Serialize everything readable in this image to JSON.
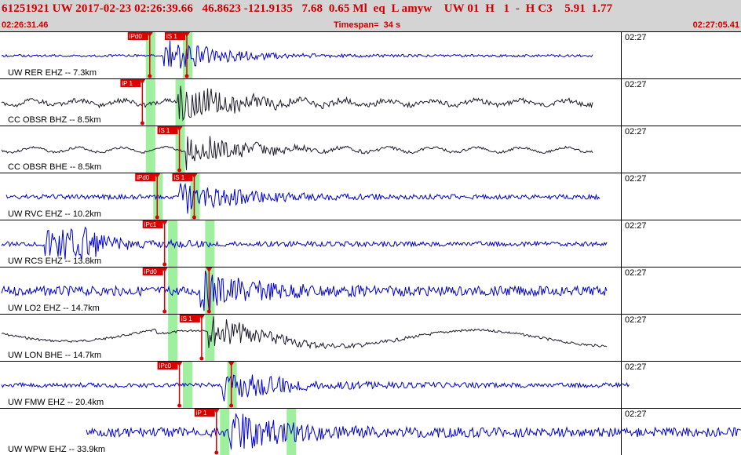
{
  "header": {
    "event_line": "61251921 UW 2017-02-23 02:26:39.66   46.8623 -121.9135   7.68  0.65 Ml  eq  L amyw    UW 01  H   1  -  H C3    5.91  1.77",
    "start_time": "02:26:31.46",
    "timespan": "Timespan=  34 s",
    "end_time": "02:27:05.41"
  },
  "time_marker": "02:27",
  "colors": {
    "header_bg": "#d4d4d4",
    "header_text": "#cc0000",
    "trace_blue": "#0000cc",
    "trace_black": "#1a1a2a",
    "pick": "#dd0000",
    "window": "#9ef09e"
  },
  "traces": [
    {
      "label": "UW RER EHZ -- 7.3km",
      "color": "blue",
      "seed": 1,
      "picks": [
        {
          "label": "iPd0",
          "t": 0.2
        },
        {
          "label": "iS 1",
          "t": 0.25
        }
      ],
      "windows": [
        0.2,
        0.25
      ],
      "burst_t": 0.22,
      "end_t": 0.8,
      "noise": "low",
      "swell": false
    },
    {
      "label": "CC OBSR BHZ -- 8.5km",
      "color": "black",
      "seed": 2,
      "picks": [
        {
          "label": "iP 1",
          "t": 0.19
        }
      ],
      "windows": [
        0.2,
        0.24
      ],
      "burst_t": 0.24,
      "end_t": 0.8,
      "noise": "mid",
      "swell": false
    },
    {
      "label": "CC OBSR BHE -- 8.5km",
      "color": "black",
      "seed": 3,
      "picks": [
        {
          "label": "iS 1",
          "t": 0.24
        }
      ],
      "windows": [
        0.2,
        0.24
      ],
      "burst_t": 0.25,
      "end_t": 0.8,
      "noise": "low",
      "swell": false
    },
    {
      "label": "UW RVC EHZ -- 10.2km",
      "color": "blue",
      "seed": 4,
      "picks": [
        {
          "label": "iPd0",
          "t": 0.21
        },
        {
          "label": "iS 1",
          "t": 0.26
        }
      ],
      "windows": [
        0.21,
        0.26
      ],
      "burst_t": 0.24,
      "end_t": 0.81,
      "noise": "mid",
      "swell": false
    },
    {
      "label": "UW RCS EHZ -- 13.8km",
      "color": "blue",
      "seed": 5,
      "picks": [
        {
          "label": "iPc1",
          "t": 0.22
        }
      ],
      "windows": [
        0.23,
        0.28
      ],
      "burst_t": 0.06,
      "end_t": 0.82,
      "noise": "mid",
      "swell": false
    },
    {
      "label": "UW LO2 EHZ -- 14.7km",
      "color": "blue",
      "seed": 6,
      "picks": [
        {
          "label": "iPd0",
          "t": 0.22
        },
        {
          "label": "",
          "t": 0.28
        }
      ],
      "windows": [
        0.23,
        0.28
      ],
      "burst_t": 0.27,
      "end_t": 0.82,
      "noise": "high",
      "swell": false
    },
    {
      "label": "UW LON BHE -- 14.7km",
      "color": "black",
      "seed": 7,
      "picks": [
        {
          "label": "iS 1",
          "t": 0.27
        }
      ],
      "windows": [
        0.23,
        0.28
      ],
      "burst_t": 0.28,
      "end_t": 0.82,
      "noise": "low",
      "swell": true
    },
    {
      "label": "UW FMW EHZ -- 20.4km",
      "color": "blue",
      "seed": 8,
      "picks": [
        {
          "label": "iPc0",
          "t": 0.24
        },
        {
          "label": "",
          "t": 0.31
        }
      ],
      "windows": [
        0.25,
        0.31
      ],
      "burst_t": 0.3,
      "end_t": 0.85,
      "noise": "mid",
      "swell": false
    },
    {
      "label": "UW WPW EHZ -- 33.9km",
      "color": "blue",
      "seed": 9,
      "picks": [
        {
          "label": "iP 1",
          "t": 0.29
        }
      ],
      "windows": [
        0.3,
        0.39
      ],
      "burst_t": 0.31,
      "end_t": 1.0,
      "noise": "high",
      "swell": false
    }
  ]
}
